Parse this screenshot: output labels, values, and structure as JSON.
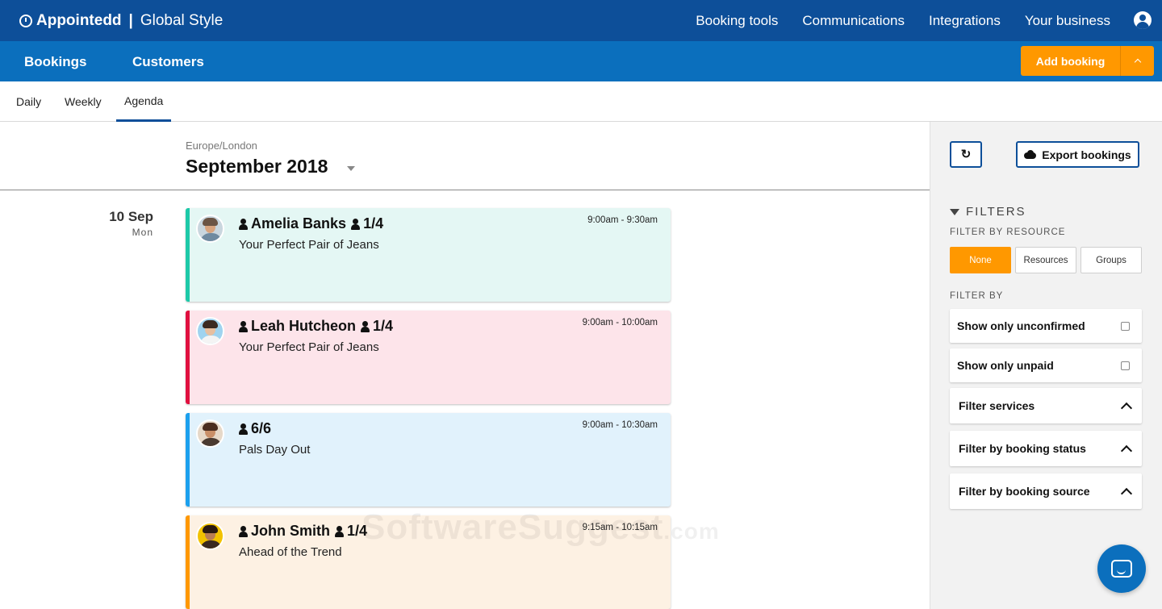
{
  "topbar": {
    "app_name": "Appointedd",
    "separator": "|",
    "business_name": "Global Style",
    "nav": [
      "Booking tools",
      "Communications",
      "Integrations",
      "Your business"
    ]
  },
  "subbar": {
    "bookings_label": "Bookings",
    "customers_label": "Customers",
    "add_booking_label": "Add booking"
  },
  "tabs": {
    "daily": "Daily",
    "weekly": "Weekly",
    "agenda": "Agenda",
    "active": "Agenda"
  },
  "agenda": {
    "timezone": "Europe/London",
    "month": "September 2018",
    "date_day": "10 Sep",
    "date_dow": "Mon",
    "bookings": [
      {
        "customer": "Amelia Banks",
        "capacity": "1/4",
        "service": "Your Perfect Pair of Jeans",
        "time": "9:00am - 9:30am",
        "color": "#1dc9a8",
        "bg": "#e4f7f4"
      },
      {
        "customer": "Leah Hutcheon",
        "capacity": "1/4",
        "service": "Your Perfect Pair of Jeans",
        "time": "9:00am - 10:00am",
        "color": "#e0103f",
        "bg": "#fde4ea"
      },
      {
        "customer": "",
        "capacity": "6/6",
        "service": "Pals Day Out",
        "time": "9:00am - 10:30am",
        "color": "#1ca0ee",
        "bg": "#e1f2fc"
      },
      {
        "customer": "John Smith",
        "capacity": "1/4",
        "service": "Ahead of the Trend",
        "time": "9:15am - 10:15am",
        "color": "#ff9800",
        "bg": "#fdf1e3"
      }
    ]
  },
  "watermark": {
    "main": "SoftwareSuggest",
    "tld": ".com"
  },
  "sidebar": {
    "export_label": "Export bookings",
    "filters_heading": "FILTERS",
    "filter_by_resource_heading": "FILTER BY RESOURCE",
    "resource_options": [
      "None",
      "Resources",
      "Groups"
    ],
    "resource_selected": "None",
    "filter_by_heading": "FILTER BY",
    "show_unconfirmed": "Show only unconfirmed",
    "show_unpaid": "Show only unpaid",
    "filter_services": "Filter services",
    "filter_status": "Filter by booking status",
    "filter_source": "Filter by booking source"
  },
  "colors": {
    "topbar": "#0d4f99",
    "subbar": "#0b6fbd",
    "accent": "#ff9800"
  }
}
